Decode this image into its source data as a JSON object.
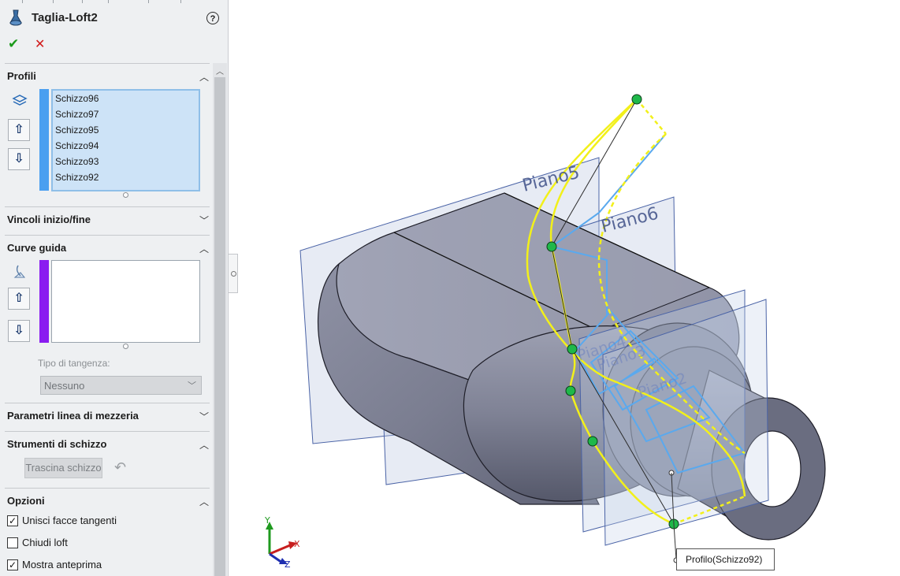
{
  "feature": {
    "title": "Taglia-Loft2"
  },
  "profili": {
    "header": "Profili",
    "items": [
      "Schizzo96",
      "Schizzo97",
      "Schizzo95",
      "Schizzo94",
      "Schizzo93",
      "Schizzo92"
    ]
  },
  "vincoli": {
    "header": "Vincoli inizio/fine"
  },
  "curve_guida": {
    "header": "Curve guida",
    "tangency_label": "Tipo di tangenza:",
    "tangency_value": "Nessuno"
  },
  "parametri": {
    "header": "Parametri linea di mezzeria"
  },
  "strumenti": {
    "header": "Strumenti di schizzo",
    "drag_button": "Trascina schizzo"
  },
  "opzioni": {
    "header": "Opzioni",
    "options": [
      {
        "label": "Unisci facce tangenti",
        "checked": true
      },
      {
        "label": "Chiudi loft",
        "checked": false
      },
      {
        "label": "Mostra anteprima",
        "checked": true
      }
    ]
  },
  "viewport": {
    "planes": [
      "Piano5",
      "Piano6",
      "Piano4",
      "Piano3",
      "Piano2"
    ],
    "callout": "Profilo(Schizzo92)",
    "axes": {
      "x": "X",
      "y": "Y",
      "z": "Z"
    }
  },
  "colors": {
    "profile_bar": "#4a9ff0",
    "guide_bar": "#8a1cf0",
    "sketch_yellow": "#f2f01a",
    "sketch_blue": "#5aa9ee",
    "point_green": "#1fb84a",
    "model_grey": "#8a8d9e"
  }
}
